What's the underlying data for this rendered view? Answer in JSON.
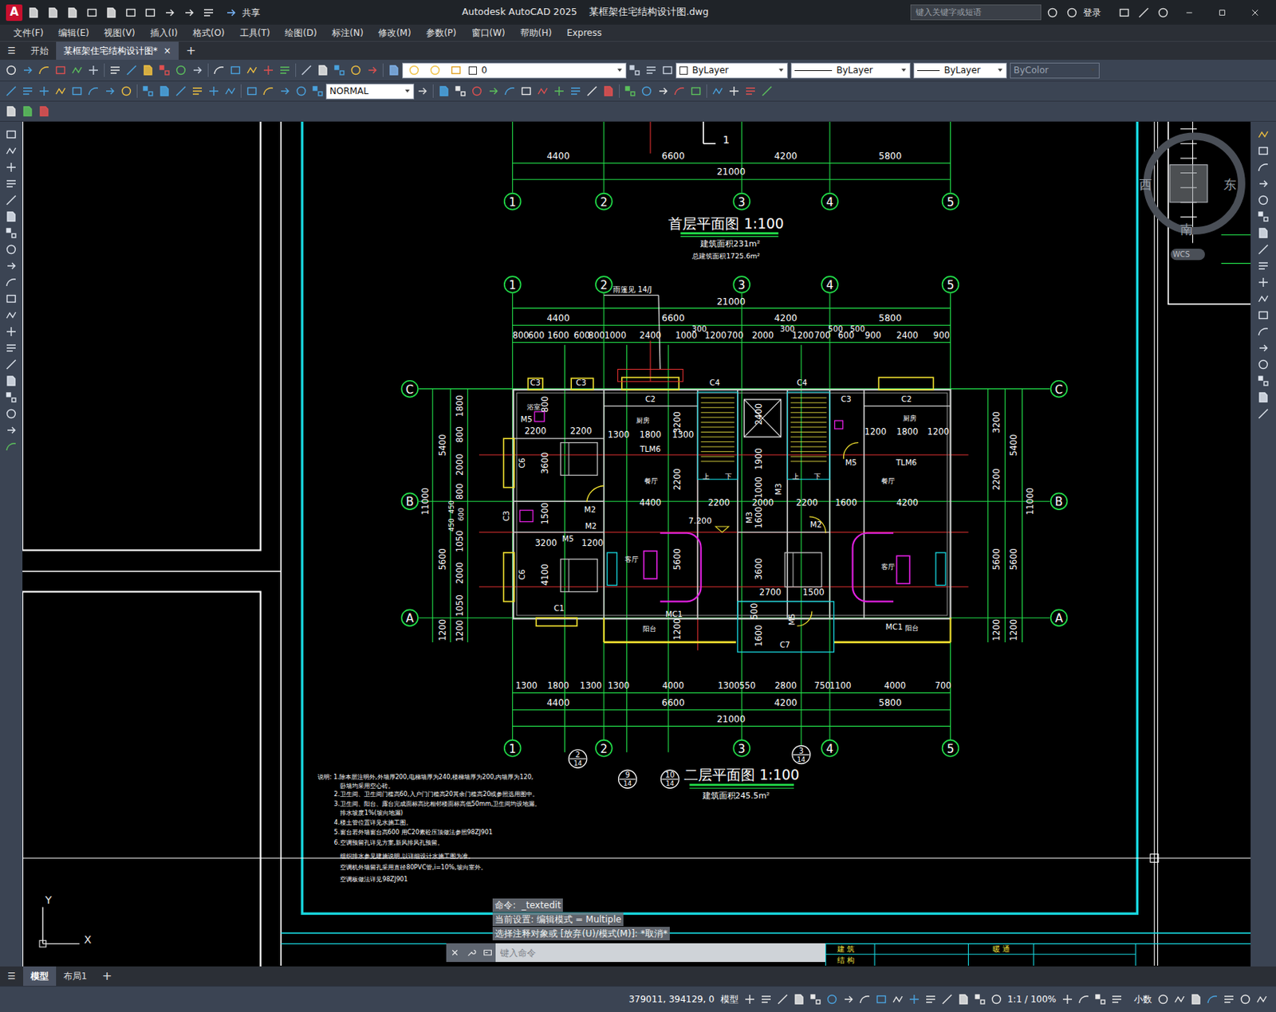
{
  "window": {
    "logo": "A",
    "title": "Autodesk AutoCAD 2025    某框架住宅结构设计图.dwg",
    "share": "共享",
    "search_placeholder": "键入关键字或短语",
    "login": "登录"
  },
  "menu": [
    "文件(F)",
    "编辑(E)",
    "视图(V)",
    "插入(I)",
    "格式(O)",
    "工具(T)",
    "绘图(D)",
    "标注(N)",
    "修改(M)",
    "参数(P)",
    "窗口(W)",
    "帮助(H)",
    "Express"
  ],
  "doc_tabs": {
    "menu": "☰",
    "new": "+",
    "close": "×",
    "items": [
      {
        "label": "开始",
        "selected": false,
        "closable": false
      },
      {
        "label": "某框架住宅结构设计图*",
        "selected": true,
        "closable": true
      }
    ]
  },
  "properties": {
    "layer": "0",
    "color": "ByLayer",
    "linetype": "ByLayer",
    "lineweight": "ByLayer",
    "plotstyle": "ByColor",
    "plotstyle_disabled": true,
    "dimstyle": "NORMAL"
  },
  "viewcube": {
    "west": "西",
    "east": "东",
    "south": "南",
    "ucs": "WCS"
  },
  "ucs_icon": {
    "y": "Y",
    "x": "X"
  },
  "command_line": {
    "history": [
      "命令:  _textedit",
      "当前设置: 编辑模式 = Multiple",
      "选择注释对象或 [放弃(U)/模式(M)]: *取消*"
    ],
    "placeholder": "键入命令"
  },
  "layout_tabs": {
    "menu": "☰",
    "new": "+",
    "items": [
      {
        "label": "模型",
        "selected": true
      },
      {
        "label": "布局1",
        "selected": false
      }
    ]
  },
  "status_bar": {
    "coords": "379011, 394129, 0",
    "space": "模型",
    "scale": "1:1 / 100%",
    "units": "小数"
  },
  "drawing": {
    "plan1": {
      "marker": "1",
      "spans": [
        "4400",
        "6600",
        "4200",
        "5800"
      ],
      "overall": "21000",
      "axes": [
        "1",
        "2",
        "3",
        "4",
        "5"
      ],
      "title": "首层平面图 1:100",
      "area": "建筑面积231m²",
      "total_area": "总建筑面积1725.6m²"
    },
    "plan2": {
      "axes_top": [
        "1",
        "2",
        "3",
        "4",
        "5"
      ],
      "note_canopy": "雨篷见 14/J",
      "overall_top": "21000",
      "spans_top": [
        "4400",
        "6600",
        "4200",
        "5800"
      ],
      "details_top": [
        "800",
        "600",
        "1600",
        "600",
        "800",
        "1000",
        "2400",
        "1000",
        "1200",
        "700",
        "2000",
        "1200",
        "700",
        "600",
        "900",
        "2400",
        "900"
      ],
      "offsets_top": [
        "300",
        "300",
        "500",
        "500"
      ],
      "rows_left": [
        "C",
        "B",
        "A"
      ],
      "rows_right": [
        "C",
        "B",
        "A"
      ],
      "dims_left": [
        "5400",
        "5600",
        "1200",
        "11000",
        "1800",
        "800",
        "2000",
        "800",
        "600",
        "450",
        "450",
        "1050",
        "2000",
        "1050",
        "1200"
      ],
      "dims_right": [
        "3200",
        "2200",
        "5600",
        "1200",
        "5400",
        "5600",
        "1200",
        "11000"
      ],
      "inner_h": [
        "2200",
        "2200",
        "1300",
        "1800",
        "1300",
        "4400",
        "2200",
        "2000",
        "2200",
        "1600",
        "4200",
        "1200",
        "1800",
        "1200",
        "3200",
        "1200",
        "2700",
        "1500"
      ],
      "inner_v": [
        "800",
        "3600",
        "1500",
        "4100",
        "3200",
        "2200",
        "5600",
        "1200",
        "2400",
        "1900",
        "1000",
        "1600",
        "3600",
        "500",
        "1600"
      ],
      "rooms": [
        "浴室",
        "厨房",
        "厨房",
        "餐厅",
        "餐厅",
        "客厅",
        "客厅",
        "阳台",
        "阳台"
      ],
      "openings": [
        "C3",
        "C3",
        "C2",
        "C4",
        "C4",
        "C3",
        "C2",
        "C6",
        "C6",
        "C3",
        "C1",
        "M5",
        "M2",
        "M2",
        "M5",
        "M3",
        "M3",
        "M2",
        "M5",
        "M5",
        "TLM6",
        "TLM6",
        "MC1",
        "MC1",
        "C7"
      ],
      "stairs": [
        "上",
        "下",
        "上",
        "下"
      ],
      "level": "7.200",
      "details_bottom": [
        "1300",
        "1800",
        "1300",
        "1300",
        "4000",
        "1300",
        "550",
        "2800",
        "750",
        "1100",
        "4000",
        "700"
      ],
      "spans_bottom": [
        "4400",
        "6600",
        "4200",
        "5800"
      ],
      "overall_bottom": "21000",
      "axes_bottom": [
        "1",
        "2",
        "3",
        "4",
        "5"
      ],
      "callouts": [
        {
          "num": "2",
          "sheet": "14"
        },
        {
          "num": "9",
          "sheet": "14"
        },
        {
          "num": "10",
          "sheet": "14"
        },
        {
          "num": "3",
          "sheet": "14"
        }
      ],
      "title": "二层平面图 1:100",
      "area": "建筑面积245.5m²"
    },
    "notes": [
      "说明:  1.除本层注明外,外墙厚200,电梯墙厚为240,楼梯墙厚为200,内墙厚为120,",
      "卧墙均采用空心砖。",
      "2.卫生间、卫生间门槛高60,入户门门槛高20其余门槛高20或参照选用图中。",
      "3.卫生间、阳台、露台完成面标高比相邻楼面标高低50mm,卫生间均设地漏。",
      "排水坡度1%(坡向地漏)",
      "4.楼土管位置详见水施工图。",
      "5.窗台若外墙窗台高600 用C20素砼压顶做法参照98ZJ901",
      "6.空调预留孔详见方案,新风排风孔预留。",
      "组织排水参见建施说明,以详细设计水施工图为准。",
      "空调机外墙留孔采用直径80PVC管,i=10%,坡向室外。",
      "空调板做法详见98ZJ901"
    ],
    "title_block": [
      "建 筑",
      "结 构",
      "暖 通"
    ]
  }
}
